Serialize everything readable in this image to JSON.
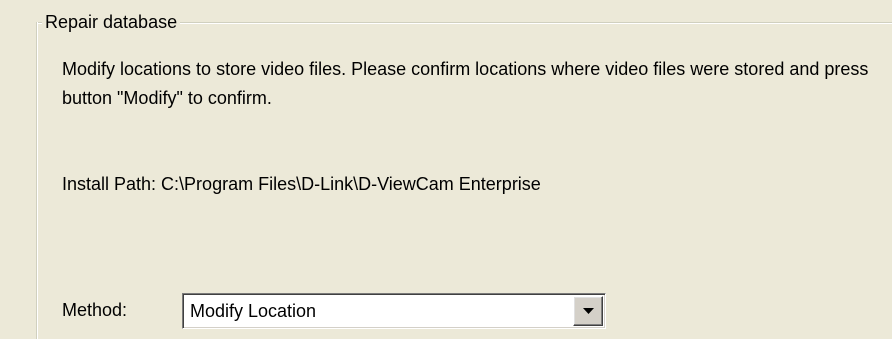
{
  "groupbox": {
    "title": "Repair database"
  },
  "description": "Modify locations to store video files. Please confirm locations where video files were stored and press button \"Modify\" to confirm.",
  "install_path": {
    "text": "Install Path: C:\\Program Files\\D-Link\\D-ViewCam Enterprise"
  },
  "method": {
    "label": "Method:",
    "selected": "Modify Location"
  },
  "icons": {
    "dropdown": "chevron-down-icon"
  },
  "colors": {
    "background": "#ECE9D8",
    "field": "#FFFFFF",
    "button_face": "#D4D0C8"
  }
}
